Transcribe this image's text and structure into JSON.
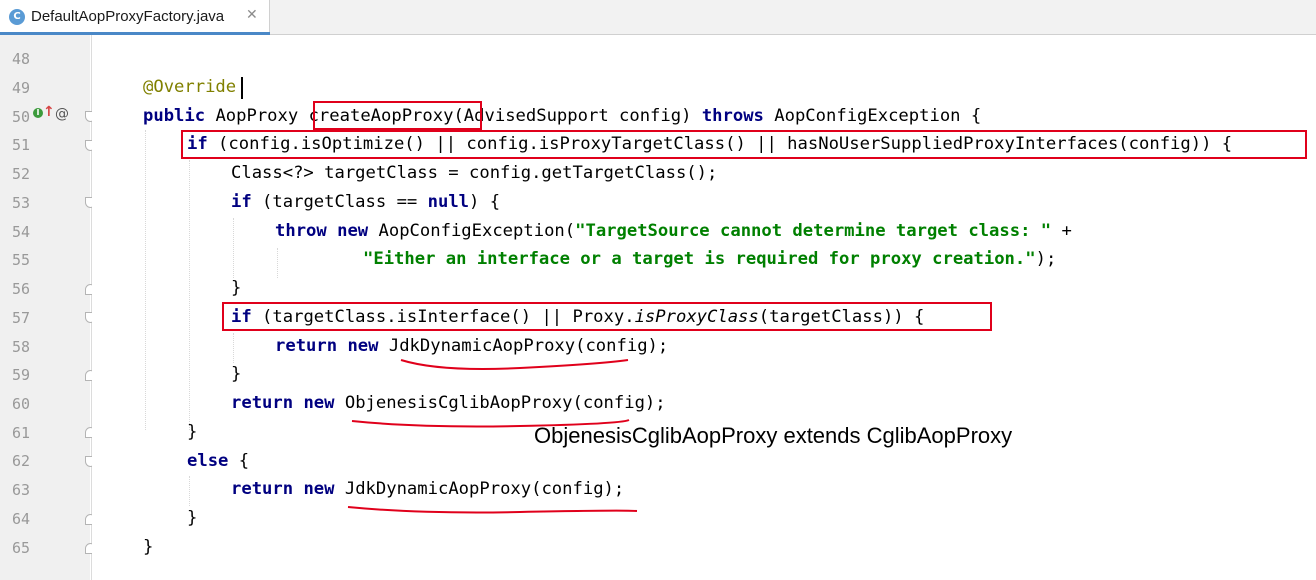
{
  "tab": {
    "file_icon": "C",
    "title": "DefaultAopProxyFactory.java",
    "close": "✕"
  },
  "gutter": {
    "line_numbers": [
      "48",
      "49",
      "50",
      "51",
      "52",
      "53",
      "54",
      "55",
      "56",
      "57",
      "58",
      "59",
      "60",
      "61",
      "62",
      "63",
      "64",
      "65"
    ],
    "impl_icon": "I",
    "up_arrow": "↑",
    "at_icon": "@"
  },
  "code": {
    "l49_annotation": "@Override",
    "l50": {
      "public": "public",
      "ret": " AopProxy ",
      "method": "createAopProxy",
      "params": "(AdvisedSupport config) ",
      "throws": "throws",
      "exc": " AopConfigException {"
    },
    "l51": {
      "if": "if",
      "cond": " (config.isOptimize() || config.isProxyTargetClass() || hasNoUserSuppliedProxyInterfaces(config)) {"
    },
    "l52": "Class<?> targetClass = config.getTargetClass();",
    "l53": {
      "if": "if",
      "open": " (targetClass == ",
      "null": "null",
      "close": ") {"
    },
    "l54": {
      "throw": "throw",
      "new": "new",
      "cls": " AopConfigException(",
      "str": "\"TargetSource cannot determine target class: \"",
      "plus": " +"
    },
    "l55": {
      "str": "\"Either an interface or a target is required for proxy creation.\"",
      "end": ");"
    },
    "l56": "}",
    "l57": {
      "if": "if",
      "a": " (targetClass.isInterface() || Proxy.",
      "italic": "isProxyClass",
      "b": "(targetClass)) {"
    },
    "l58": {
      "return": "return",
      "new": "new",
      "rest": " JdkDynamicAopProxy(config);"
    },
    "l59": "}",
    "l60": {
      "return": "return",
      "new": "new",
      "rest": " ObjenesisCglibAopProxy(config);"
    },
    "l61": "}",
    "l62": {
      "else": "else",
      "rest": " {"
    },
    "l63": {
      "return": "return",
      "new": "new",
      "rest": " JdkDynamicAopProxy(config);"
    },
    "l64": "}",
    "l65": "}"
  },
  "annotation_note": "ObjenesisCglibAopProxy extends CglibAopProxy",
  "colors": {
    "keyword": "#000080",
    "string": "#008000",
    "annotation": "#808000",
    "highlight_box": "#e0001b",
    "underline": "#e0001b",
    "tab_accent": "#4a88c7"
  }
}
